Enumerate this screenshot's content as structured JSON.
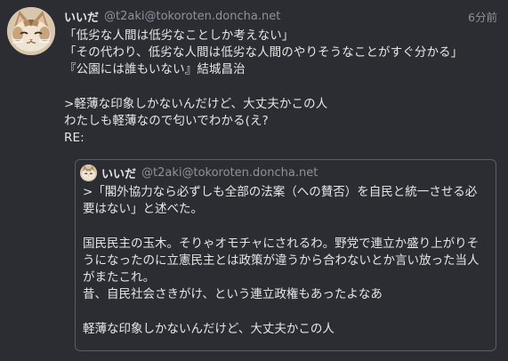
{
  "note": {
    "display_name": "いいだ",
    "username": "@t2aki@tokoroten.doncha.net",
    "time": "6分前",
    "text": "「低劣な人間は低劣なことしか考えない」\n「その代わり、低劣な人間は低劣な人間のやりそうなことがすぐ分かる」\n『公園には誰もいない』結城昌治\n\n>軽薄な印象しかないんだけど、大丈夫かこの人\nわたしも軽薄なので匂いでわかる(え?\nRE:"
  },
  "quote": {
    "display_name": "いいだ",
    "username": "@t2aki@tokoroten.doncha.net",
    "text": ">「閣外協力なら必ずしも全部の法案（への賛否）を自民と統一させる必要はない」と述べた。\n\n国民民主の玉木。そりゃオモチャにされるわ。野党で連立か盛り上がりそうになったのに立憲民主とは政策が違うから合わないとか言い放った当人がまたこれ。\n昔、自民社会さきがけ、という連立政権もあったよなあ\n\n軽薄な印象しかないんだけど、大丈夫かこの人"
  },
  "icons": {
    "avatar": "cat-face-icon"
  },
  "colors": {
    "background": "#2b2d33",
    "text": "#e6e6e6",
    "muted": "#8e929a",
    "border": "#5a5e66"
  }
}
